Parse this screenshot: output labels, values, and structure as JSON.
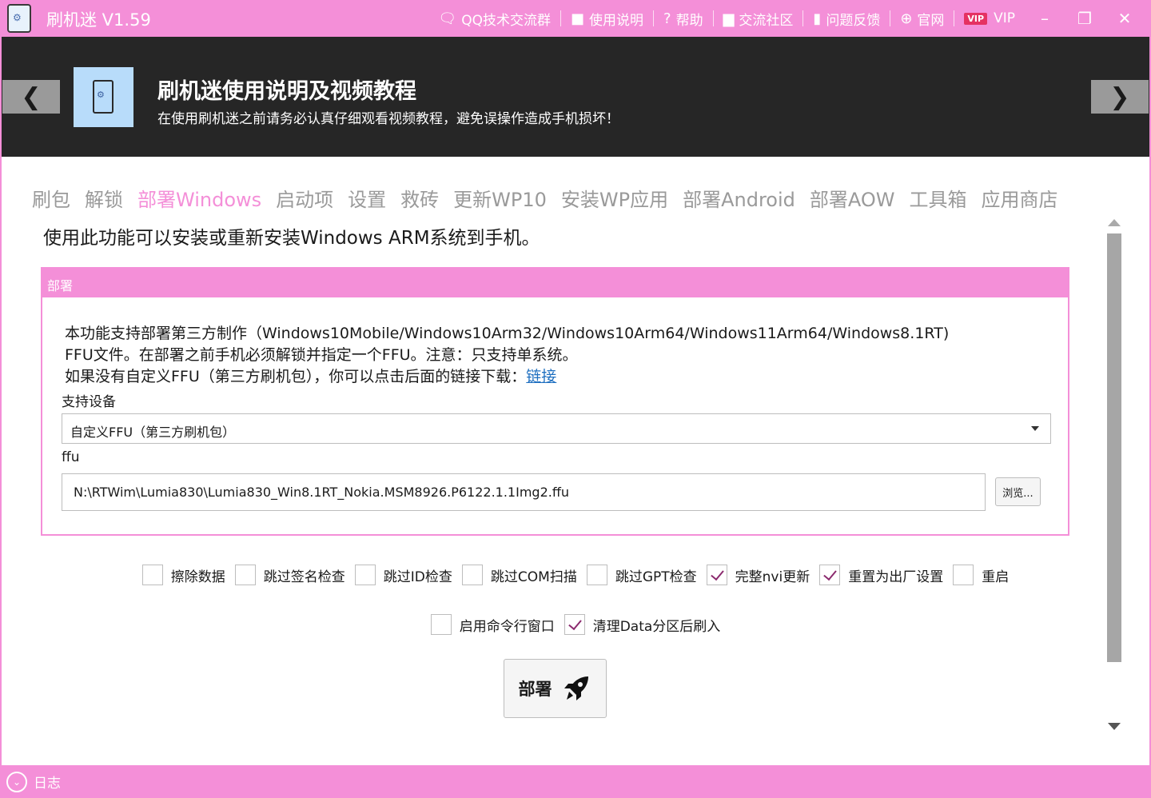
{
  "app": {
    "title": "刷机迷 V1.59"
  },
  "topmenu": [
    {
      "icon": "chat-bubble-icon",
      "glyph": "🗨",
      "label": "QQ技术交流群"
    },
    {
      "icon": "video-camera-icon",
      "glyph": "■",
      "label": "使用说明"
    },
    {
      "icon": "help-icon",
      "glyph": "?",
      "label": "帮助"
    },
    {
      "icon": "community-icon",
      "glyph": "▆",
      "label": "交流社区"
    },
    {
      "icon": "feedback-icon",
      "glyph": "▮",
      "label": "问题反馈"
    },
    {
      "icon": "globe-icon",
      "glyph": "⊕",
      "label": "官网"
    },
    {
      "icon": "vip-icon",
      "glyph": "VIP",
      "label": "VIP"
    }
  ],
  "window": {
    "minimize": "–",
    "maximize": "❐",
    "close": "✕"
  },
  "banner": {
    "title": "刷机迷使用说明及视频教程",
    "subtitle": "在使用刷机迷之前请务必认真仔细观看视频教程，避免误操作造成手机损坏！",
    "prev": "❮",
    "next": "❯"
  },
  "tabs": [
    {
      "label": "刷包",
      "active": false
    },
    {
      "label": "解锁",
      "active": false
    },
    {
      "label": "部署Windows",
      "active": true
    },
    {
      "label": "启动项",
      "active": false
    },
    {
      "label": "设置",
      "active": false
    },
    {
      "label": "救砖",
      "active": false
    },
    {
      "label": "更新WP10",
      "active": false
    },
    {
      "label": "安装WP应用",
      "active": false
    },
    {
      "label": "部署Android",
      "active": false
    },
    {
      "label": "部署AOW",
      "active": false
    },
    {
      "label": "工具箱",
      "active": false
    },
    {
      "label": "应用商店",
      "active": false
    }
  ],
  "intro": "使用此功能可以安装或重新安装Windows ARM系统到手机。",
  "group": {
    "header": "部署",
    "desc_line1": "本功能支持部署第三方制作（Windows10Mobile/Windows10Arm32/Windows10Arm64/Windows11Arm64/Windows8.1RT)",
    "desc_line2": "FFU文件。在部署之前手机必须解锁并指定一个FFU。注意：只支持单系统。",
    "desc_line3": "如果没有自定义FFU（第三方刷机包），你可以点击后面的链接下载：",
    "link": "链接",
    "device_label": "支持设备",
    "device_value": "自定义FFU（第三方刷机包）",
    "ffu_label": "ffu",
    "ffu_path": "N:\\RTWim\\Lumia830\\Lumia830_Win8.1RT_Nokia.MSM8926.P6122.1.1Img2.ffu",
    "browse": "浏览..."
  },
  "options_row1": [
    {
      "label": "擦除数据",
      "checked": false
    },
    {
      "label": "跳过签名检查",
      "checked": false
    },
    {
      "label": "跳过ID检查",
      "checked": false
    },
    {
      "label": "跳过COM扫描",
      "checked": false
    },
    {
      "label": "跳过GPT检查",
      "checked": false
    },
    {
      "label": "完整nvi更新",
      "checked": true
    },
    {
      "label": "重置为出厂设置",
      "checked": true
    },
    {
      "label": "重启",
      "checked": false
    }
  ],
  "options_row2": [
    {
      "label": "启用命令行窗口",
      "checked": false
    },
    {
      "label": "清理Data分区后刷入",
      "checked": true
    }
  ],
  "deploy": {
    "label": "部署"
  },
  "footer": {
    "log_label": "日志"
  }
}
